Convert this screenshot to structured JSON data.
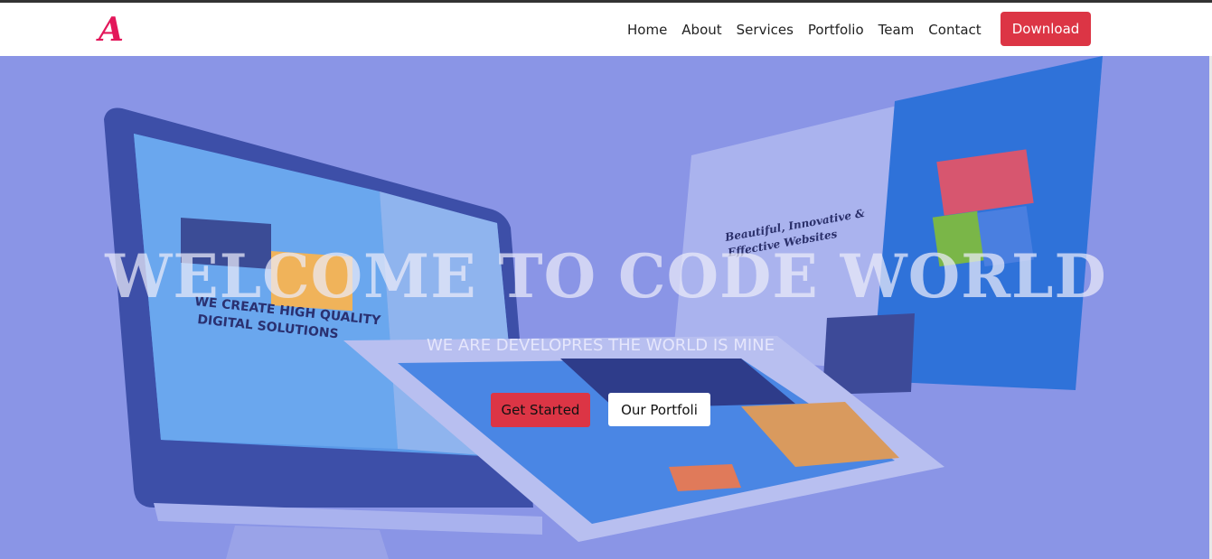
{
  "header": {
    "logo_letter": "A",
    "nav": [
      "Home",
      "About",
      "Services",
      "Portfolio",
      "Team",
      "Contact"
    ],
    "download_label": "Download"
  },
  "hero": {
    "title": "WELCOME TO CODE WORLD",
    "subtitle": "WE ARE DEVELOPRES THE WORLD IS MINE",
    "cta_primary": "Get Started",
    "cta_secondary": "Our Portfoli",
    "background_texts": {
      "monitor_headline_1": "WE CREATE HIGH QUALITY",
      "monitor_headline_2": "DIGITAL SOLUTIONS",
      "panel_headline_1": "Beautiful, Innovative &",
      "panel_headline_2": "Effective Websites"
    }
  },
  "colors": {
    "accent": "#dc3545",
    "logo": "#e3175a",
    "hero_overlay": "#8a95e6"
  }
}
